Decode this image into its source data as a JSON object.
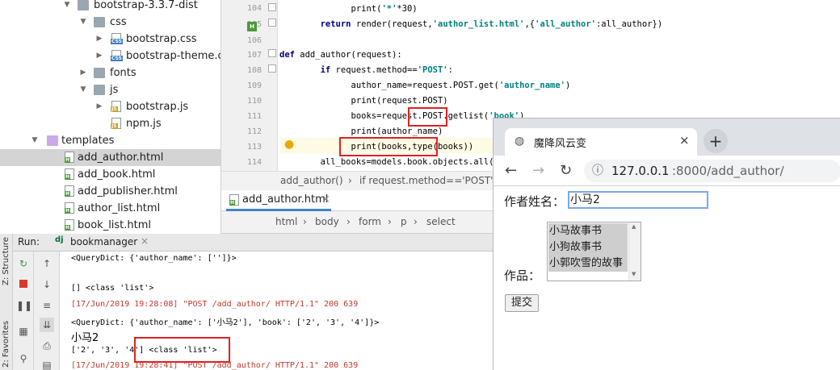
{
  "tree": {
    "items": [
      {
        "label": "bootstrap-3.3.7-dist",
        "icon": "folder"
      },
      {
        "label": "css",
        "icon": "folder"
      },
      {
        "label": "bootstrap.css",
        "icon": "css-file"
      },
      {
        "label": "bootstrap-theme.css",
        "icon": "css-file"
      },
      {
        "label": "fonts",
        "icon": "folder"
      },
      {
        "label": "js",
        "icon": "folder"
      },
      {
        "label": "bootstrap.js",
        "icon": "js-file"
      },
      {
        "label": "npm.js",
        "icon": "js-file"
      },
      {
        "label": "templates",
        "icon": "folder"
      },
      {
        "label": "add_author.html",
        "icon": "html-file"
      },
      {
        "label": "add_book.html",
        "icon": "html-file"
      },
      {
        "label": "add_publisher.html",
        "icon": "html-file"
      },
      {
        "label": "author_list.html",
        "icon": "html-file"
      },
      {
        "label": "book_list.html",
        "icon": "html-file"
      }
    ]
  },
  "editor": {
    "line_numbers": [
      "104",
      "105",
      "106",
      "107",
      "108",
      "109",
      "110",
      "111",
      "112",
      "113",
      "114"
    ],
    "breadcrumb": {
      "func": "add_author()",
      "sep": "›",
      "branch": "if request.method=='POST'"
    }
  },
  "file_tab": {
    "label": "add_author.html",
    "close": "×"
  },
  "path_bar": {
    "items": [
      "html",
      "body",
      "form",
      "p",
      "select"
    ],
    "sep": "›"
  },
  "run": {
    "label": "Run:",
    "config": "bookmanager",
    "close": "×"
  },
  "side_tabs": {
    "structure": "Z: Structure",
    "favorites": "2: Favorites"
  },
  "console": {
    "lines": [
      "<QueryDict: {'author_name': ['']}>",
      "",
      "[] <class 'list'>",
      "[17/Jun/2019 19:28:08] \"POST /add_author/ HTTP/1.1\" 200 639",
      "<QueryDict: {'author_name': ['小马2'], 'book': ['2', '3', '4']}>",
      "小马2",
      "['2', '3', '4'] <class 'list'>",
      "[17/Jun/2019 19:28:41] \"POST /add_author/ HTTP/1.1\" 200 639"
    ]
  },
  "browser": {
    "tab_title": "魔降风云变",
    "tab_close": "×",
    "new_tab": "+",
    "url_host": "127.0.0.1",
    "url_rest": ":8000/add_author/",
    "form": {
      "name_label": "作者姓名：",
      "name_value": "小马2",
      "works_label": "作品：",
      "options": [
        "小马故事书",
        "小狗故事书",
        "小郭吹雪的故事"
      ],
      "submit": "提交"
    }
  },
  "colors": {
    "highlight_box": "#e02020",
    "keyword": "#000080",
    "string": "#008080",
    "log_red": "#c0392b"
  }
}
